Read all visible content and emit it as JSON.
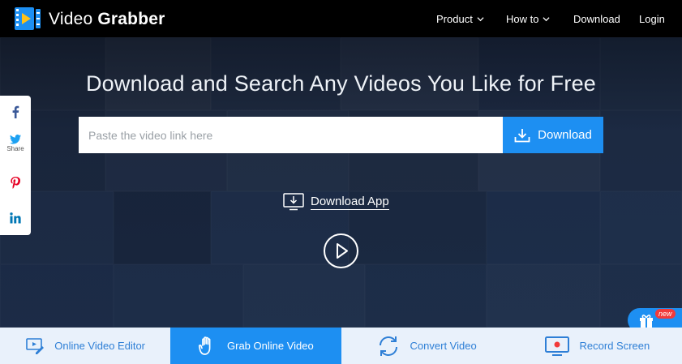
{
  "header": {
    "brand_part1": "Video",
    "brand_part2": "Grabber",
    "nav": [
      {
        "label": "Product",
        "dropdown": true
      },
      {
        "label": "How to",
        "dropdown": true
      },
      {
        "label": "Download",
        "dropdown": false
      },
      {
        "label": "Login",
        "dropdown": false
      }
    ]
  },
  "hero": {
    "headline": "Download and Search Any Videos You Like for Free",
    "search_placeholder": "Paste the video link here",
    "search_value": "",
    "download_button": "Download",
    "download_app": "Download App"
  },
  "share": {
    "label": "Share",
    "items": [
      "facebook-icon",
      "twitter-icon",
      "pinterest-icon",
      "linkedin-icon"
    ]
  },
  "gift": {
    "badge": "new",
    "icon": "gift-icon"
  },
  "bottom_tabs": [
    {
      "label": "Online Video Editor",
      "icon": "video-editor-icon",
      "active": false
    },
    {
      "label": "Grab Online Video",
      "icon": "hand-icon",
      "active": true
    },
    {
      "label": "Convert Video",
      "icon": "convert-icon",
      "active": false
    },
    {
      "label": "Record Screen",
      "icon": "record-screen-icon",
      "active": false
    }
  ],
  "colors": {
    "accent": "#1d8ff2",
    "header_bg": "#000000",
    "bottom_bar_bg": "#e9f1fb",
    "bottom_text": "#2e7fd6",
    "badge": "#f23b3b"
  }
}
